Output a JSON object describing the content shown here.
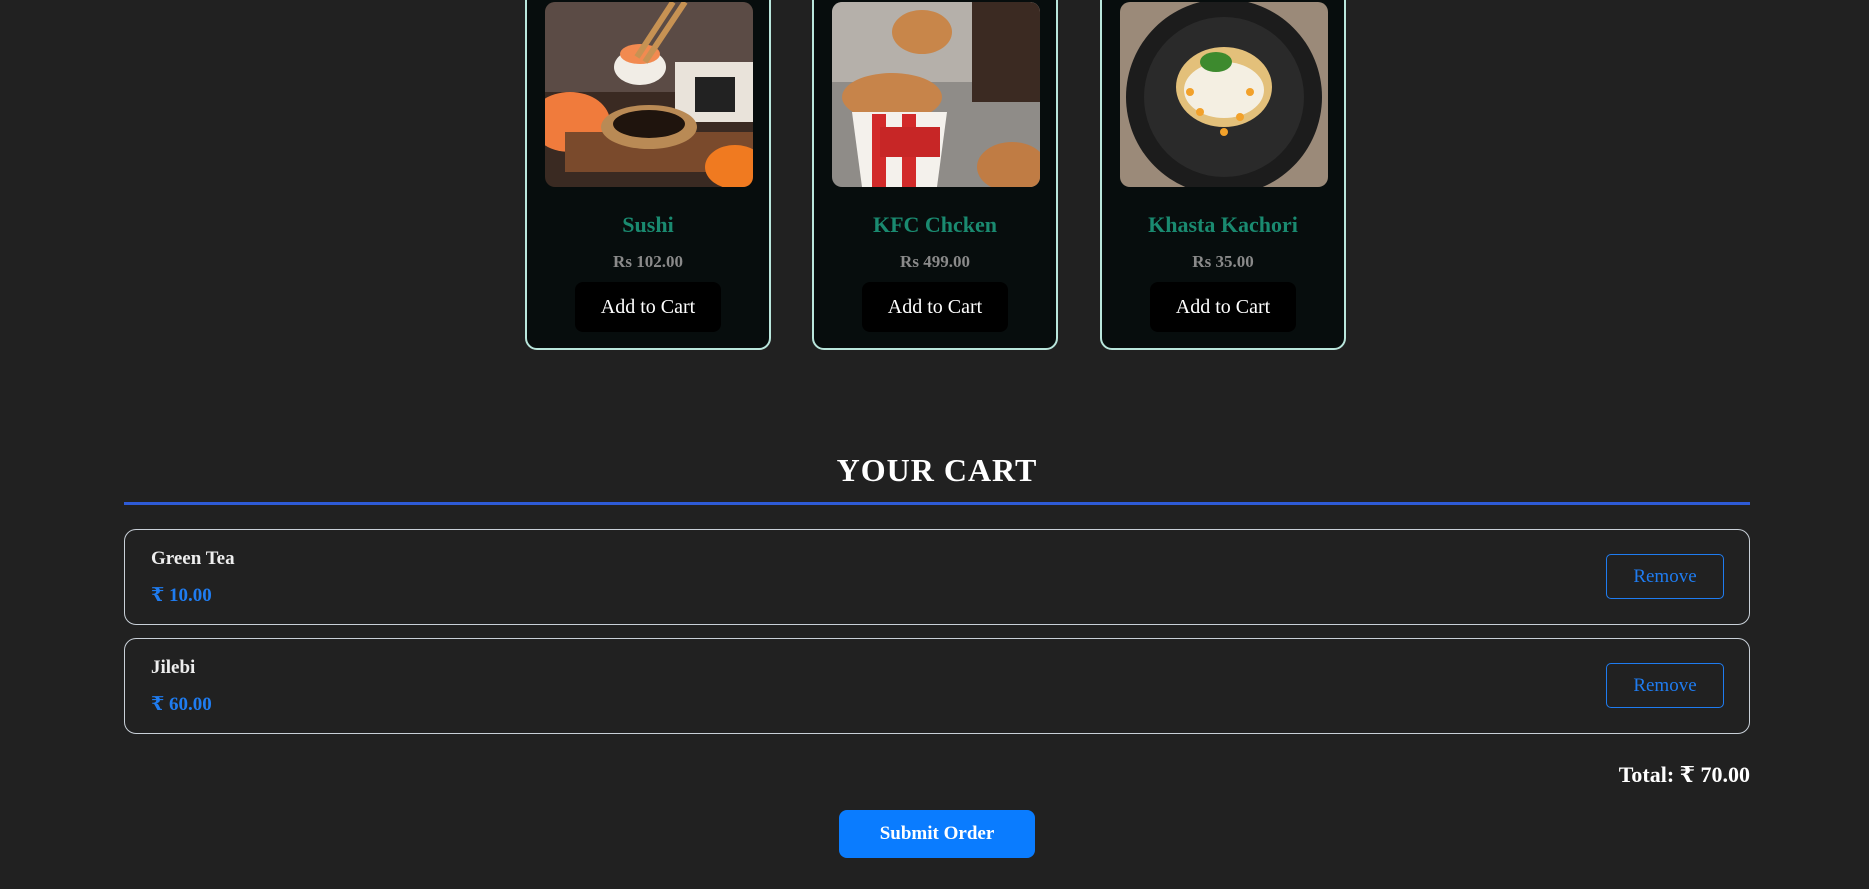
{
  "products": [
    {
      "name": "Sushi",
      "price": "Rs 102.00",
      "button": "Add to Cart",
      "image": "sushi-photo"
    },
    {
      "name": "KFC Chcken",
      "price": "Rs 499.00",
      "button": "Add to Cart",
      "image": "fried-chicken-bucket-photo"
    },
    {
      "name": "Khasta Kachori",
      "price": "Rs 35.00",
      "button": "Add to Cart",
      "image": "kachori-plate-photo"
    }
  ],
  "cart": {
    "title": "YOUR CART",
    "items": [
      {
        "name": "Green Tea",
        "price": "₹ 10.00",
        "remove_label": "Remove"
      },
      {
        "name": "Jilebi",
        "price": "₹ 60.00",
        "remove_label": "Remove"
      }
    ],
    "total": "Total: ₹ 70.00",
    "submit_label": "Submit Order"
  },
  "colors": {
    "background": "#212121",
    "card_background": "#070d0d",
    "product_name": "#1a8a70",
    "accent_blue": "#0a7cff",
    "rule_blue": "#2e5bd6"
  }
}
